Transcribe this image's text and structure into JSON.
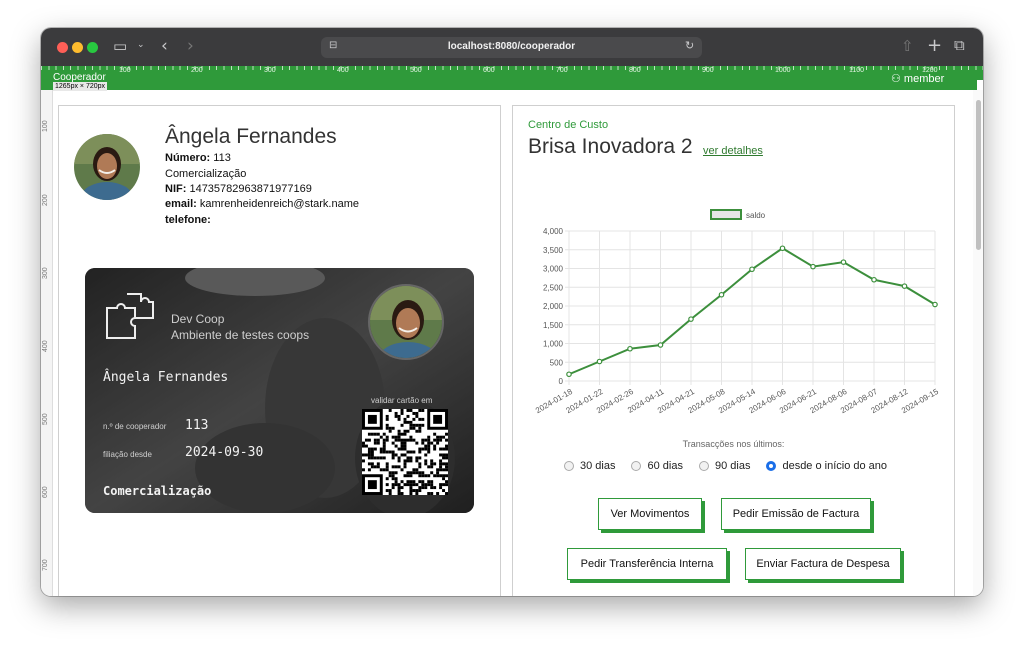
{
  "browser": {
    "url": "localhost:8080/cooperador",
    "traffic_colors": [
      "#fe5f57",
      "#febc2e",
      "#28c840"
    ]
  },
  "ruler": {
    "title": "Cooperador",
    "size": "1265px × 720px",
    "ticks": [
      "100",
      "200",
      "300",
      "400",
      "500",
      "600",
      "700",
      "800",
      "900",
      "1000",
      "1100",
      "1200"
    ],
    "vticks": [
      "100",
      "200",
      "300",
      "400",
      "500",
      "600",
      "700"
    ],
    "user": "member"
  },
  "profile": {
    "name": "Ângela Fernandes",
    "numero_label": "Número:",
    "numero": "113",
    "setor": "Comercialização",
    "nif_label": "NIF:",
    "nif": "14735782963871977169",
    "email_label": "email:",
    "email": "kamrenheidenreich@stark.name",
    "telefone_label": "telefone:",
    "telefone": ""
  },
  "card": {
    "org": "Dev Coop",
    "org_sub": "Ambiente de testes coops",
    "name": "Ângela Fernandes",
    "num_label": "n.º de cooperador",
    "num": "113",
    "since_label": "filiação desde",
    "since": "2024-09-30",
    "sector": "Comercialização",
    "validate_label": "validar cartão em"
  },
  "cost_center": {
    "label": "Centro de Custo",
    "name": "Brisa Inovadora 2",
    "details_link": "ver detalhes"
  },
  "chart_data": {
    "type": "line",
    "series": [
      {
        "name": "saldo",
        "x": [
          "2024-01-18",
          "2024-01-22",
          "2024-02-26",
          "2024-04-11",
          "2024-04-21",
          "2024-05-08",
          "2024-05-14",
          "2024-06-06",
          "2024-06-21",
          "2024-08-06",
          "2024-08-07",
          "2024-08-12",
          "2024-09-15"
        ],
        "values": [
          180,
          520,
          860,
          960,
          1650,
          2300,
          2980,
          3540,
          3050,
          3170,
          2700,
          2530,
          2040
        ]
      }
    ],
    "ylim": [
      0,
      4000
    ],
    "yticks": [
      "0",
      "500",
      "1,000",
      "1,500",
      "2,000",
      "2,500",
      "3,000",
      "3,500",
      "4,000"
    ],
    "legend_position": "top",
    "grid": true,
    "color": "#3c8f3c"
  },
  "period": {
    "label": "Transacções nos últimos:",
    "options": [
      "30 dias",
      "60 dias",
      "90 dias",
      "desde o início do ano"
    ],
    "selected": 3
  },
  "actions": {
    "movimentos": "Ver Movimentos",
    "factura": "Pedir Emissão de Factura",
    "transferencia": "Pedir Transferência Interna",
    "despesa": "Enviar Factura de Despesa"
  }
}
